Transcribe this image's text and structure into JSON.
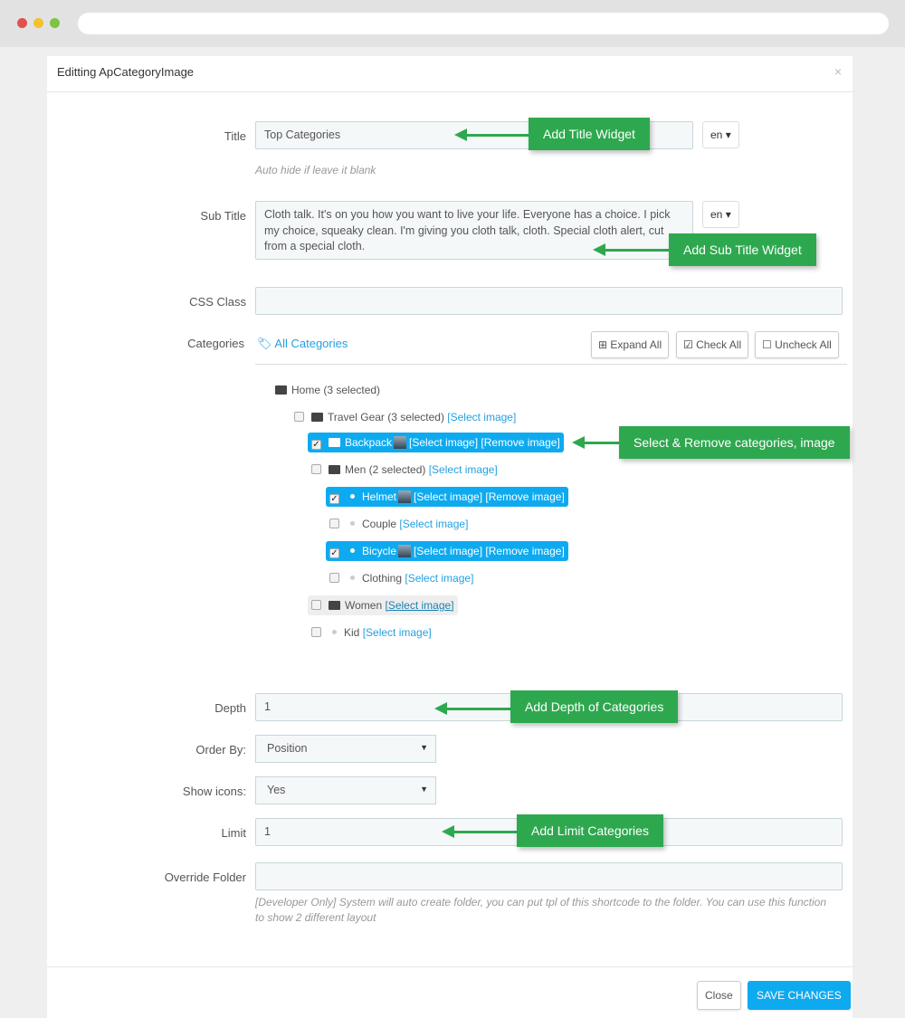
{
  "window": {
    "dots": [
      "#e0524f",
      "#f4c02c",
      "#7cc441"
    ]
  },
  "modal": {
    "title": "Editting ApCategoryImage",
    "close_symbol": "×"
  },
  "form": {
    "title": {
      "label": "Title",
      "value": "Top Categories",
      "lang": "en",
      "help": "Auto hide if leave it blank"
    },
    "subtitle": {
      "label": "Sub Title",
      "value": "Cloth talk. It's on you how you want to live your life. Everyone has a choice. I pick my choice, squeaky clean. I'm giving you cloth talk, cloth. Special cloth alert, cut from a special cloth.",
      "lang": "en"
    },
    "css_class": {
      "label": "CSS Class",
      "value": ""
    },
    "categories": {
      "label": "Categories",
      "all_label": "All Categories",
      "expand_all": "Expand All",
      "check_all": "Check All",
      "uncheck_all": "Uncheck All",
      "select_image": "[Select image]",
      "remove_image": "[Remove image]",
      "tree": [
        {
          "name": "Home (3 selected)",
          "checked": false,
          "type": "root"
        },
        {
          "name": "Travel Gear (3 selected)",
          "checked": false,
          "type": "folder-open"
        },
        {
          "name": "Backpack",
          "checked": true,
          "type": "folder"
        },
        {
          "name": "Men (2 selected)",
          "checked": false,
          "type": "folder-open"
        },
        {
          "name": "Helmet",
          "checked": true,
          "type": "leaf"
        },
        {
          "name": "Couple",
          "checked": false,
          "type": "leaf"
        },
        {
          "name": "Bicycle",
          "checked": true,
          "type": "leaf"
        },
        {
          "name": "Clothing",
          "checked": false,
          "type": "leaf"
        },
        {
          "name": "Women",
          "checked": false,
          "type": "folder"
        },
        {
          "name": "Kid",
          "checked": false,
          "type": "leaf"
        }
      ]
    },
    "depth": {
      "label": "Depth",
      "value": "1"
    },
    "order_by": {
      "label": "Order By:",
      "value": "Position"
    },
    "show_icons": {
      "label": "Show icons:",
      "value": "Yes"
    },
    "limit": {
      "label": "Limit",
      "value": "1"
    },
    "override_folder": {
      "label": "Override Folder",
      "value": "",
      "help": "[Developer Only] System will auto create folder, you can put tpl of this shortcode to the folder. You can use this function to show 2 different layout"
    }
  },
  "callouts": {
    "title": "Add Title Widget",
    "subtitle": "Add Sub Title Widget",
    "categories": "Select & Remove categories, image",
    "depth": "Add Depth of Categories",
    "limit": "Add Limit Categories"
  },
  "footer": {
    "close": "Close",
    "save": "SAVE CHANGES"
  },
  "colors": {
    "accent": "#0eaaf0",
    "callout": "#2ea84f"
  }
}
